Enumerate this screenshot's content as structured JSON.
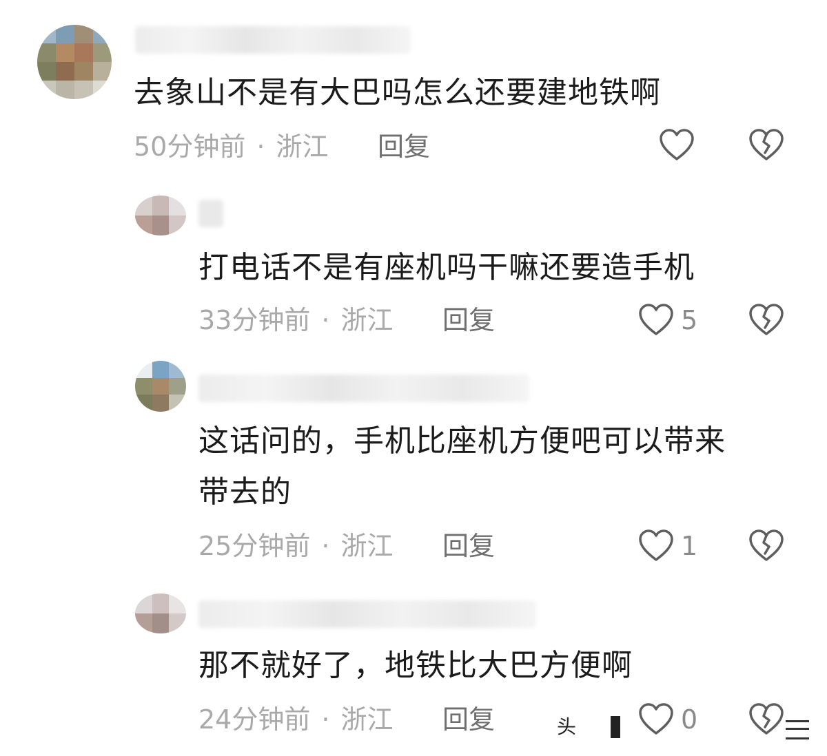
{
  "comments": [
    {
      "text_lines": [
        "去象山不是有大巴吗怎么还要建地铁啊"
      ],
      "time": "50分钟前",
      "separator": "·",
      "region": "浙江",
      "reply_label": "回复",
      "likes": ""
    },
    {
      "text_lines": [
        "打电话不是有座机吗干嘛还要造手机"
      ],
      "time": "33分钟前",
      "separator": "·",
      "region": "浙江",
      "reply_label": "回复",
      "likes": "5"
    },
    {
      "text_lines": [
        "这话问的，手机比座机方便吧可以带来",
        "带去的"
      ],
      "time": "25分钟前",
      "separator": "·",
      "region": "浙江",
      "reply_label": "回复",
      "likes": "1"
    },
    {
      "text_lines": [
        "那不就好了，地铁比大巴方便啊"
      ],
      "time": "24分钟前",
      "separator": "·",
      "region": "浙江",
      "reply_label": "回复",
      "likes": "0"
    }
  ],
  "watermark": {
    "text": "头"
  },
  "icons": {
    "like": "heart-outline-icon",
    "dislike": "broken-heart-icon"
  },
  "colors": {
    "text": "#1b1b1b",
    "meta": "#a9a9a9",
    "reply": "#6f6f6f",
    "icon": "#5e5e5e"
  }
}
